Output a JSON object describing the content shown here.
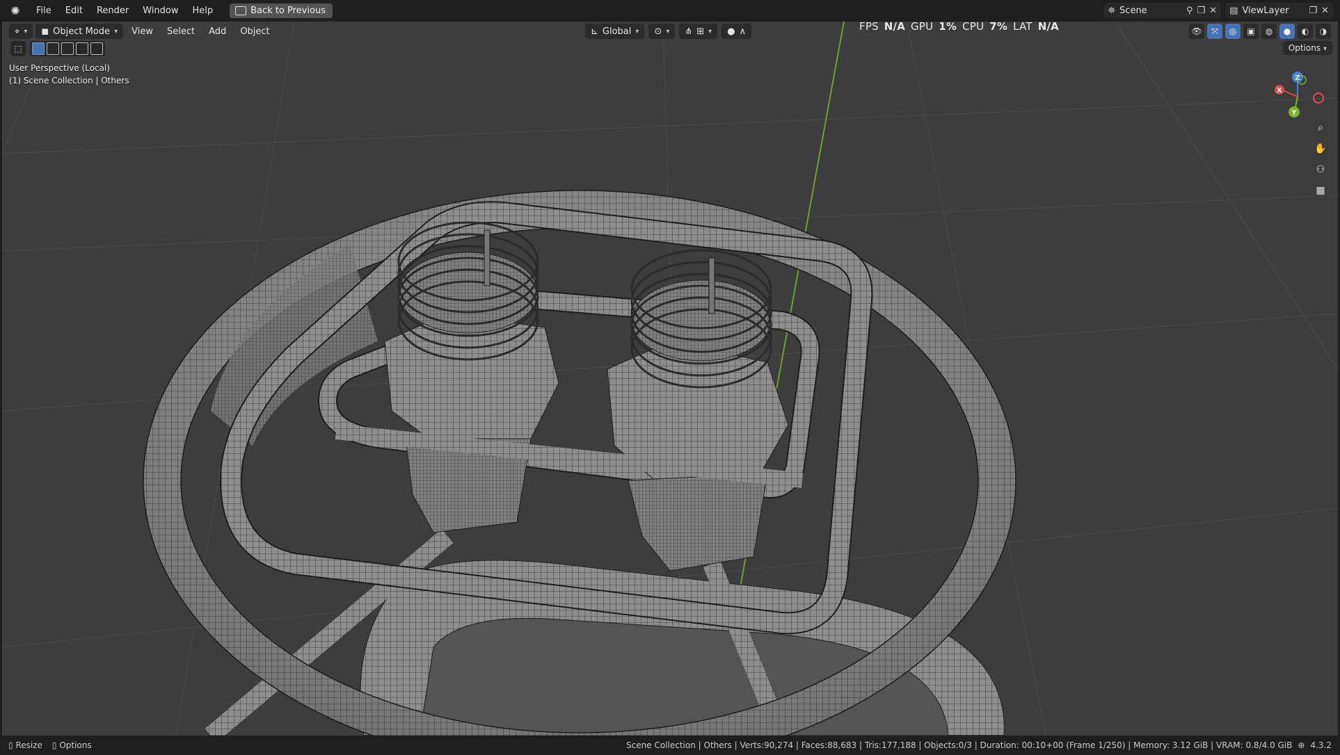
{
  "topbar": {
    "menus": [
      "File",
      "Edit",
      "Render",
      "Window",
      "Help"
    ],
    "back_button": "Back to Previous",
    "scene": "Scene",
    "view_layer": "ViewLayer"
  },
  "viewport_header": {
    "mode": "Object Mode",
    "menus": [
      "View",
      "Select",
      "Add",
      "Object"
    ],
    "orientation": "Global",
    "options": "Options"
  },
  "perf": {
    "fps_label": "FPS",
    "fps": "N/A",
    "gpu_label": "GPU",
    "gpu": "1%",
    "cpu_label": "CPU",
    "cpu": "7%",
    "lat_label": "LAT",
    "lat": "N/A"
  },
  "overlay": {
    "view": "User Perspective (Local)",
    "collection": "(1) Scene Collection | Others"
  },
  "gizmo": {
    "x": "X",
    "y": "Y",
    "z": "Z"
  },
  "statusbar": {
    "resize": "Resize",
    "options": "Options",
    "info": "Scene Collection | Others | Verts:90,274 | Faces:88,683 | Tris:177,188 | Objects:0/3 | Duration: 00:10+00 (Frame 1/250) | Memory: 3.12 GiB | VRAM: 0.8/4.0 GiB",
    "version": "4.3.2"
  },
  "colors": {
    "accent": "#4772b3",
    "x_axis": "#e04a4a",
    "y_axis": "#7ab32c",
    "z_axis": "#3d86d8"
  }
}
